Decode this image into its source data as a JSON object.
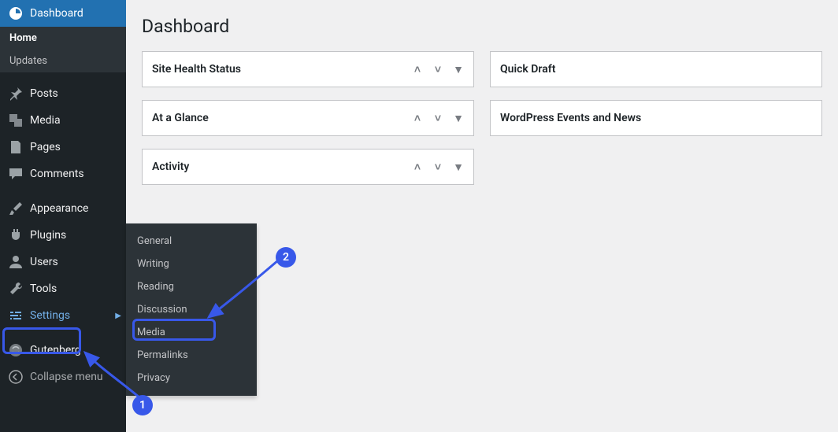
{
  "page": {
    "title": "Dashboard"
  },
  "sidebar": {
    "dashboard": "Dashboard",
    "sub_home": "Home",
    "sub_updates": "Updates",
    "posts": "Posts",
    "media": "Media",
    "pages": "Pages",
    "comments": "Comments",
    "appearance": "Appearance",
    "plugins": "Plugins",
    "users": "Users",
    "tools": "Tools",
    "settings": "Settings",
    "gutenberg": "Gutenberg",
    "collapse": "Collapse menu"
  },
  "settings_submenu": {
    "general": "General",
    "writing": "Writing",
    "reading": "Reading",
    "discussion": "Discussion",
    "media": "Media",
    "permalinks": "Permalinks",
    "privacy": "Privacy"
  },
  "panels": {
    "site_health": "Site Health Status",
    "at_a_glance": "At a Glance",
    "activity": "Activity",
    "quick_draft": "Quick Draft",
    "events": "WordPress Events and News"
  },
  "annotations": {
    "step1": "1",
    "step2": "2"
  }
}
